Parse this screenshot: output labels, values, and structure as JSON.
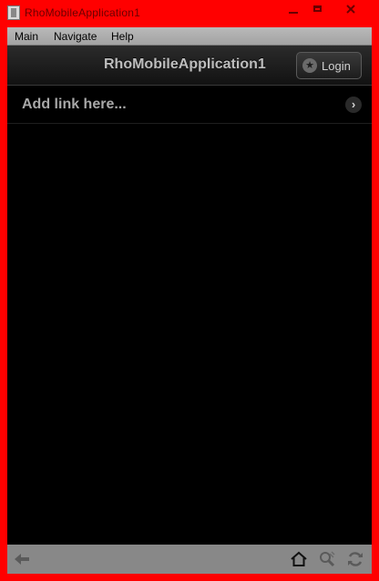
{
  "window": {
    "title": "RhoMobileApplication1"
  },
  "menubar": {
    "items": [
      {
        "label": "Main"
      },
      {
        "label": "Navigate"
      },
      {
        "label": "Help"
      }
    ]
  },
  "header": {
    "title": "RhoMobileApplication1",
    "login_label": "Login",
    "login_icon": "star-icon"
  },
  "list": {
    "items": [
      {
        "label": "Add link here...",
        "icon": "chevron-right-icon"
      }
    ]
  },
  "toolbar": {
    "icons": [
      "back-arrow-icon",
      "home-icon",
      "zoom-tool-icon",
      "refresh-icon"
    ]
  },
  "colors": {
    "frame": "#ff0000",
    "background": "#000000",
    "toolbar": "#888888"
  }
}
